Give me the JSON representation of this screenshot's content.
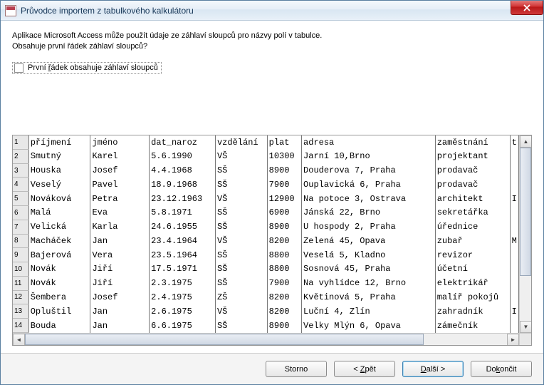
{
  "window": {
    "title": "Průvodce importem z tabulkového kalkulátoru"
  },
  "intro": {
    "line1": "Aplikace Microsoft Access může použít údaje ze záhlaví sloupců pro názvy polí v tabulce.",
    "line2": "Obsahuje první řádek záhlaví sloupců?"
  },
  "checkbox": {
    "label": "První řádek obsahuje záhlaví sloupců",
    "checked": false
  },
  "columns": [
    "příjmení",
    "jméno",
    "dat_naroz",
    "vzdělání",
    "plat",
    "adresa",
    "zaměstnání",
    ""
  ],
  "rows": [
    {
      "n": 1,
      "c": [
        "příjmení",
        "jméno",
        "dat_naroz",
        "vzdělání",
        "plat",
        "adresa",
        "zaměstnání",
        "t"
      ]
    },
    {
      "n": 2,
      "c": [
        "Smutný",
        "Karel",
        "5.6.1990",
        "VŠ",
        "10300",
        "Jarní 10,Brno",
        "projektant",
        ""
      ]
    },
    {
      "n": 3,
      "c": [
        "Houska",
        "Josef",
        "4.4.1968",
        "SŠ",
        "8900",
        "Douderova 7, Praha",
        "prodavač",
        ""
      ]
    },
    {
      "n": 4,
      "c": [
        "Veselý",
        "Pavel",
        "18.9.1968",
        "SŠ",
        "7900",
        "Ouplavická 6, Praha",
        "prodavač",
        ""
      ]
    },
    {
      "n": 5,
      "c": [
        "Nováková",
        "Petra",
        "23.12.1963",
        "VŠ",
        "12900",
        "Na potoce 3, Ostrava",
        "architekt",
        "I"
      ]
    },
    {
      "n": 6,
      "c": [
        "Malá",
        "Eva",
        "5.8.1971",
        "SŠ",
        "6900",
        "Jánská 22, Brno",
        "sekretářka",
        ""
      ]
    },
    {
      "n": 7,
      "c": [
        "Velická",
        "Karla",
        "24.6.1955",
        "SŠ",
        "8900",
        "U hospody 2, Praha",
        "úřednice",
        ""
      ]
    },
    {
      "n": 8,
      "c": [
        "Macháček",
        "Jan",
        "23.4.1964",
        "VŠ",
        "8200",
        "Zelená 45, Opava",
        "zubař",
        "M"
      ]
    },
    {
      "n": 9,
      "c": [
        "Bajerová",
        "Vera",
        "23.5.1964",
        "SŠ",
        "8800",
        "Veselá 5, Kladno",
        "revizor",
        ""
      ]
    },
    {
      "n": 10,
      "c": [
        "Novák",
        "Jiří",
        "17.5.1971",
        "SŠ",
        "8800",
        "Sosnová 45, Praha",
        "účetní",
        ""
      ]
    },
    {
      "n": 11,
      "c": [
        "Novák",
        "Jiří",
        "2.3.1975",
        "SŠ",
        "7900",
        "Na vyhlídce 12, Brno",
        "elektrikář",
        ""
      ]
    },
    {
      "n": 12,
      "c": [
        "Šembera",
        "Josef",
        "2.4.1975",
        "ZŠ",
        "8200",
        "Květinová 5, Praha",
        "malíř pokojů",
        ""
      ]
    },
    {
      "n": 13,
      "c": [
        "Opluštil",
        "Jan",
        "2.6.1975",
        "VŠ",
        "8200",
        "Luční 4, Zlín",
        "zahradník",
        "I"
      ]
    },
    {
      "n": 14,
      "c": [
        "Bouda",
        "Jan",
        "6.6.1975",
        "SŠ",
        "8900",
        "Velky Mlýn 6, Opava",
        "zámečník",
        ""
      ]
    }
  ],
  "buttons": {
    "cancel": "Storno",
    "back": "< Zpět",
    "next": "Další >",
    "finish": "Dokončit"
  }
}
